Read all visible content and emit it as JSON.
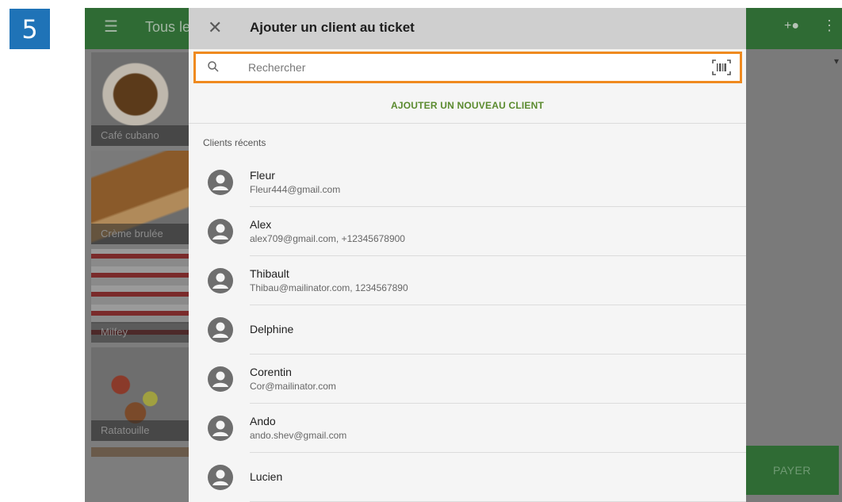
{
  "step_number": "5",
  "background_app": {
    "appbar_title": "Tous le",
    "menu_icon": "hamburger-icon",
    "add_person_icon": "person-add-icon",
    "more_icon": "more-vert-icon",
    "pay_label": "PAYER",
    "products": [
      {
        "label": "Café cubano"
      },
      {
        "label": "Crème brulée"
      },
      {
        "label": "Milfey"
      },
      {
        "label": "Ratatouille"
      }
    ]
  },
  "dialog": {
    "title": "Ajouter un client au ticket",
    "close_icon": "close-icon",
    "search": {
      "placeholder": "Rechercher",
      "value": "",
      "search_icon": "search-icon",
      "barcode_icon": "barcode-scan-icon"
    },
    "add_new_client_label": "AJOUTER UN NOUVEAU CLIENT",
    "recent_label": "Clients récents",
    "clients": [
      {
        "name": "Fleur",
        "contact": "Fleur444@gmail.com"
      },
      {
        "name": "Alex",
        "contact": "alex709@gmail.com, +12345678900"
      },
      {
        "name": "Thibault",
        "contact": "Thibau@mailinator.com, 1234567890"
      },
      {
        "name": "Delphine",
        "contact": ""
      },
      {
        "name": "Corentin",
        "contact": "Cor@mailinator.com"
      },
      {
        "name": "Ando",
        "contact": "ando.shev@gmail.com"
      },
      {
        "name": "Lucien",
        "contact": ""
      }
    ]
  },
  "colors": {
    "highlight_border": "#ef8a1f",
    "accent_green": "#5a8a2e",
    "appbar_green": "#2f6b34",
    "step_badge": "#1f73b7"
  }
}
